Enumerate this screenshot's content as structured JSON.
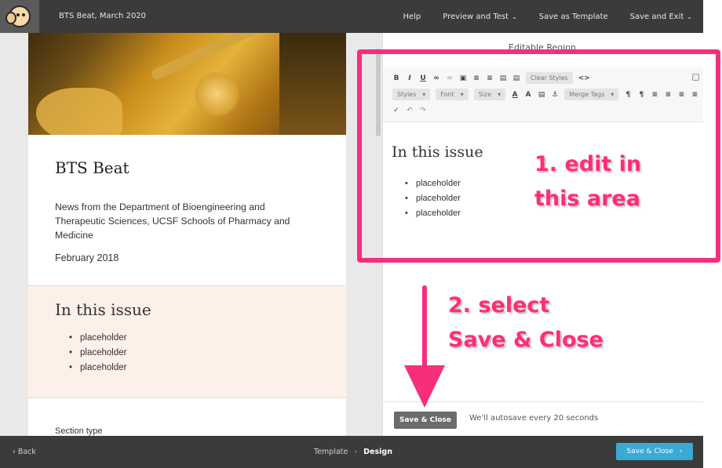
{
  "topbar": {
    "doc_title": "BTS Beat, March 2020",
    "nav": {
      "help": "Help",
      "preview_test": "Preview and Test",
      "save_template": "Save as Template",
      "save_exit": "Save and Exit"
    }
  },
  "preview": {
    "title": "BTS Beat",
    "description": "News from the Department of Bioengineering and Therapeutic Sciences, UCSF Schools of Pharmacy and Medicine",
    "date": "February 2018",
    "issue_title": "In this issue",
    "issue_items": [
      "placeholder",
      "placeholder",
      "placeholder"
    ],
    "section_type": "Section type"
  },
  "editor": {
    "heading": "Editable Region",
    "toolbar": {
      "clear_styles": "Clear Styles",
      "styles": "Styles",
      "font": "Font",
      "size": "Size",
      "merge_tags": "Merge Tags",
      "source": "<>"
    },
    "content_title": "In this issue",
    "content_items": [
      "placeholder",
      "placeholder",
      "placeholder"
    ],
    "save_close": "Save & Close",
    "autosave": "We'll autosave every 20 seconds"
  },
  "annotations": {
    "step1_line1": "1. edit in",
    "step1_line2": "this area",
    "step2_line1": "2. select",
    "step2_line2": "Save & Close",
    "accent": "#f52f7c"
  },
  "bottombar": {
    "back": "Back",
    "crumb_template": "Template",
    "crumb_design": "Design",
    "save_close": "Save & Close"
  }
}
